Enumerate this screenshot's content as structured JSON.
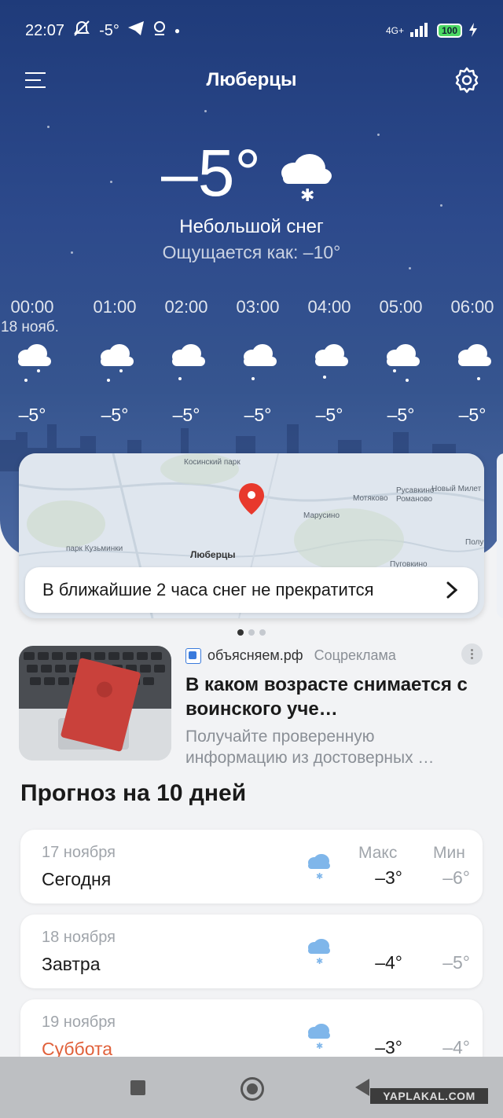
{
  "status_bar": {
    "time": "22:07",
    "temp": "-5°",
    "network": "4G+",
    "battery": "100"
  },
  "header": {
    "city": "Люберцы"
  },
  "current": {
    "temperature": "–5°",
    "condition": "Небольшой снег",
    "feels_like": "Ощущается как: –10°",
    "icon": "cloud-snow-icon"
  },
  "hourly": [
    {
      "time": "00:00",
      "date": "18 нояб.",
      "temp": "–5°"
    },
    {
      "time": "01:00",
      "temp": "–5°"
    },
    {
      "time": "02:00",
      "temp": "–5°"
    },
    {
      "time": "03:00",
      "temp": "–5°"
    },
    {
      "time": "04:00",
      "temp": "–5°"
    },
    {
      "time": "05:00",
      "temp": "–5°"
    },
    {
      "time": "06:00",
      "temp": "–5°"
    }
  ],
  "map_card": {
    "place_label": "Люберцы",
    "labels": [
      "Косинский парк",
      "Марусино",
      "Мотяково",
      "Русавкино-Романово",
      "Новый Милет",
      "Пуговкино",
      "Полуш",
      "парк Кузьминки"
    ],
    "nowcast_text": "В ближайшие 2 часа снег не прекратится"
  },
  "ad": {
    "source": "объясняем.рф",
    "tag": "Соцреклама",
    "title": "В каком возрасте снимается с воинского уче…",
    "text": "Получайте проверенную информацию из достоверных …"
  },
  "forecast": {
    "heading": "Прогноз на 10 дней",
    "max_label": "Макс",
    "min_label": "Мин",
    "days": [
      {
        "date": "17 ноября",
        "name": "Сегодня",
        "max": "–3°",
        "min": "–6°",
        "weekend": false
      },
      {
        "date": "18 ноября",
        "name": "Завтра",
        "max": "–4°",
        "min": "–5°",
        "weekend": false
      },
      {
        "date": "19 ноября",
        "name": "Суббота",
        "max": "–3°",
        "min": "–4°",
        "weekend": true
      }
    ]
  },
  "watermark": "YAPLAKAL.COM",
  "colors": {
    "hero_top": "#1f3b7a",
    "hero_bottom": "#4a67a0",
    "weekend": "#e0603a",
    "pin": "#e8392c",
    "snow_icon": "#7fb6ea"
  }
}
